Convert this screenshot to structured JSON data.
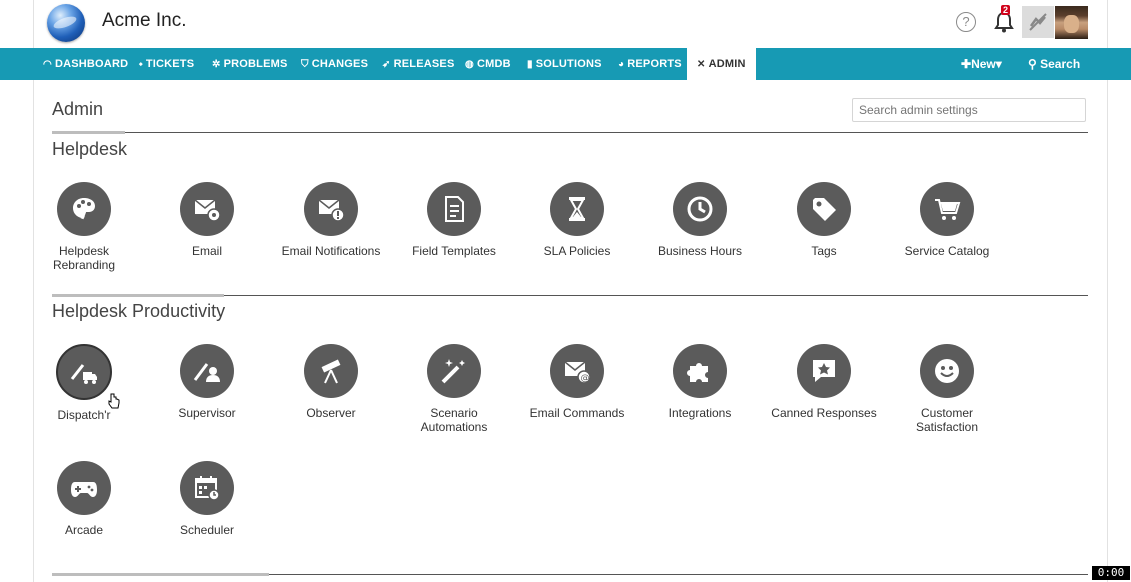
{
  "header": {
    "company": "Acme Inc.",
    "help_glyph": "?",
    "notification_count": "2",
    "icons": [
      "globe-logo",
      "help-icon",
      "bell-icon",
      "status-icon",
      "avatar"
    ]
  },
  "nav": {
    "items": [
      {
        "label": "DASHBOARD",
        "icon": "dashboard-icon",
        "glyph": "◠"
      },
      {
        "label": "TICKETS",
        "icon": "ticket-icon",
        "glyph": "⬩"
      },
      {
        "label": "PROBLEMS",
        "icon": "bug-icon",
        "glyph": "✲"
      },
      {
        "label": "CHANGES",
        "icon": "shield-icon",
        "glyph": "⛉"
      },
      {
        "label": "RELEASES",
        "icon": "rocket-icon",
        "glyph": "➶"
      },
      {
        "label": "CMDB",
        "icon": "cube-icon",
        "glyph": "◍"
      },
      {
        "label": "SOLUTIONS",
        "icon": "book-icon",
        "glyph": "▮"
      },
      {
        "label": "REPORTS",
        "icon": "pie-icon",
        "glyph": "◕"
      },
      {
        "label": "ADMIN",
        "icon": "tools-icon",
        "glyph": "✕"
      }
    ],
    "new_label": "New",
    "search_label": "Search"
  },
  "page": {
    "title": "Admin",
    "search_placeholder": "Search admin settings"
  },
  "sections": [
    {
      "title": "Helpdesk",
      "tiles": [
        {
          "label": "Helpdesk Rebranding",
          "icon": "palette-icon"
        },
        {
          "label": "Email",
          "icon": "email-settings-icon"
        },
        {
          "label": "Email Notifications",
          "icon": "email-notification-icon"
        },
        {
          "label": "Field Templates",
          "icon": "document-icon"
        },
        {
          "label": "SLA Policies",
          "icon": "hourglass-icon"
        },
        {
          "label": "Business Hours",
          "icon": "clock-icon"
        },
        {
          "label": "Tags",
          "icon": "tag-icon"
        },
        {
          "label": "Service Catalog",
          "icon": "cart-icon"
        }
      ]
    },
    {
      "title": "Helpdesk Productivity",
      "tiles": [
        {
          "label": "Dispatch'r",
          "icon": "truck-wand-icon"
        },
        {
          "label": "Supervisor",
          "icon": "supervisor-wand-icon"
        },
        {
          "label": "Observer",
          "icon": "telescope-icon"
        },
        {
          "label": "Scenario Automations",
          "icon": "magic-wand-icon"
        },
        {
          "label": "Email Commands",
          "icon": "email-at-icon"
        },
        {
          "label": "Integrations",
          "icon": "puzzle-icon"
        },
        {
          "label": "Canned Responses",
          "icon": "chat-star-icon"
        },
        {
          "label": "Customer Satisfaction",
          "icon": "smiley-icon"
        },
        {
          "label": "Arcade",
          "icon": "gamepad-icon"
        },
        {
          "label": "Scheduler",
          "icon": "calendar-clock-icon"
        }
      ]
    }
  ],
  "timer": "0:00"
}
